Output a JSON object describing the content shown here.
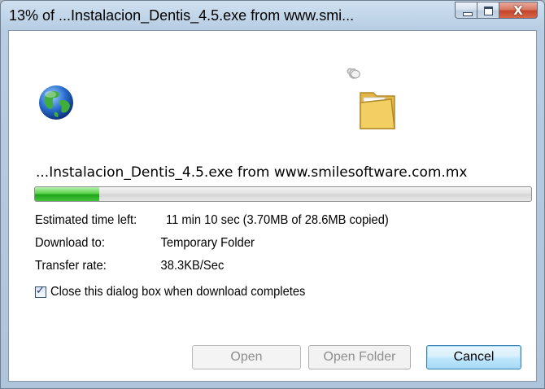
{
  "window": {
    "title": "13% of ...Instalacion_Dentis_4.5.exe from www.smi...",
    "caption_buttons": {
      "minimize_icon": "minimize-icon",
      "maximize_icon": "maximize-icon",
      "close_icon": "close-icon",
      "close_glyph": "X"
    }
  },
  "icons": {
    "source": "globe-icon",
    "destination": "folder-icon"
  },
  "download": {
    "filename_line": "...Instalacion_Dentis_4.5.exe from www.smilesoftware.com.mx",
    "progress_fraction": 0.13,
    "estimated_label": "Estimated time left:",
    "estimated_value": "11 min 10 sec (3.70MB of 28.6MB copied)",
    "download_to_label": "Download to:",
    "download_to_value": "Temporary Folder",
    "transfer_rate_label": "Transfer rate:",
    "transfer_rate_value": "38.3KB/Sec"
  },
  "close_on_complete": {
    "checked": true,
    "label": "Close this dialog box when download completes"
  },
  "buttons": {
    "open": "Open",
    "open_folder": "Open Folder",
    "cancel": "Cancel"
  },
  "colors": {
    "progress_green": "#1fa51a",
    "titlebar_blue": "#b7cde3",
    "close_red": "#c4452a"
  }
}
